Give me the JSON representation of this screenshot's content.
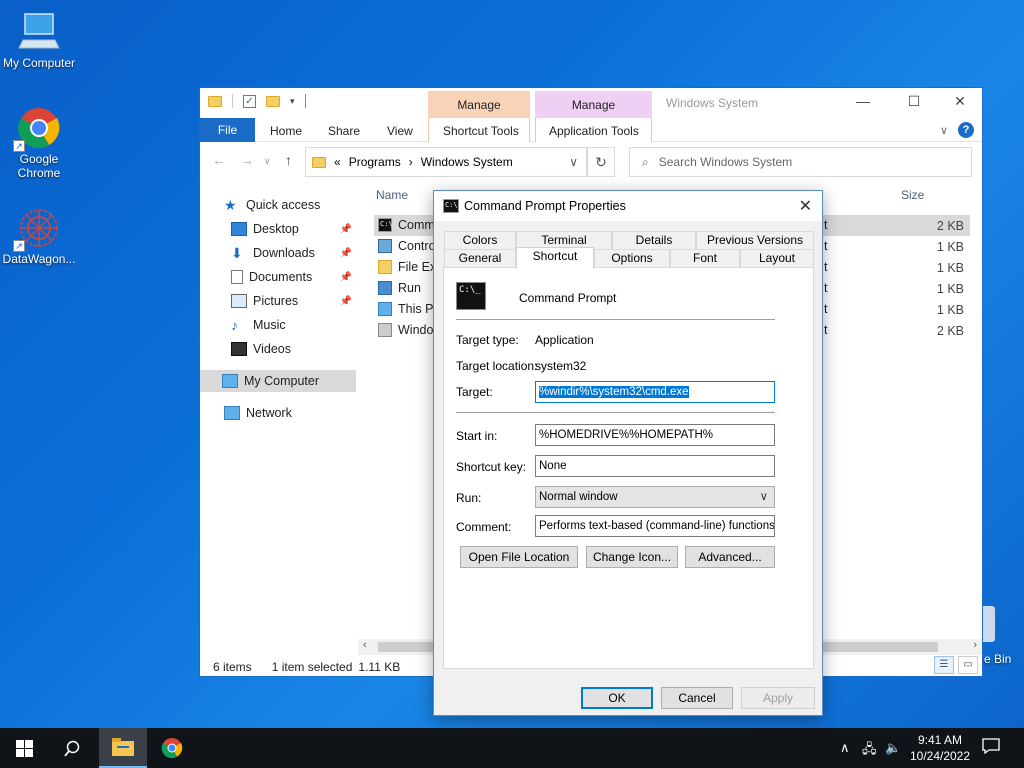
{
  "desktop": {
    "icons": [
      {
        "label": "My Computer"
      },
      {
        "label": "Google Chrome"
      },
      {
        "label": "DataWagon..."
      }
    ],
    "recycle_partial": "e Bin"
  },
  "explorer": {
    "title": "Windows System",
    "context_tabs": [
      {
        "header": "Manage",
        "tab": "Shortcut Tools",
        "color": "#f9d3b8"
      },
      {
        "header": "Manage",
        "tab": "Application Tools",
        "color": "#eed0f4"
      }
    ],
    "ribbon_tabs": [
      "File",
      "Home",
      "Share",
      "View"
    ],
    "address": {
      "chevron": "«",
      "parts": [
        "Programs",
        "Windows System"
      ]
    },
    "search_placeholder": "Search Windows System",
    "nav": [
      {
        "label": "Quick access"
      },
      {
        "label": "Desktop"
      },
      {
        "label": "Downloads"
      },
      {
        "label": "Documents"
      },
      {
        "label": "Pictures"
      },
      {
        "label": "Music"
      },
      {
        "label": "Videos"
      },
      {
        "label": "My Computer"
      },
      {
        "label": "Network"
      }
    ],
    "columns": {
      "name": "Name",
      "size": "Size"
    },
    "files": [
      {
        "name": "Comm",
        "size": "2 KB",
        "suffix": "t"
      },
      {
        "name": "Contro",
        "size": "1 KB",
        "suffix": "t"
      },
      {
        "name": "File Exp",
        "size": "1 KB",
        "suffix": "t"
      },
      {
        "name": "Run",
        "size": "1 KB",
        "suffix": "t"
      },
      {
        "name": "This PC",
        "size": "1 KB",
        "suffix": "t"
      },
      {
        "name": "Windov",
        "size": "2 KB",
        "suffix": "t"
      }
    ],
    "status": {
      "items": "6 items",
      "selected": "1 item selected",
      "size": "1.11 KB"
    }
  },
  "dialog": {
    "title": "Command Prompt Properties",
    "tabs_row1": [
      "Colors",
      "Terminal",
      "Details",
      "Previous Versions"
    ],
    "tabs_row2": [
      "General",
      "Shortcut",
      "Options",
      "Font",
      "Layout"
    ],
    "active_tab": "Shortcut",
    "app_name": "Command Prompt",
    "target_type_label": "Target type:",
    "target_type": "Application",
    "target_location_label": "Target location:",
    "target_location": "system32",
    "target_label": "Target:",
    "target": "%windir%\\system32\\cmd.exe",
    "start_in_label": "Start in:",
    "start_in": "%HOMEDRIVE%%HOMEPATH%",
    "shortcut_key_label": "Shortcut key:",
    "shortcut_key": "None",
    "run_label": "Run:",
    "run": "Normal window",
    "comment_label": "Comment:",
    "comment": "Performs text-based (command-line) functions.",
    "buttons": {
      "open_location": "Open File Location",
      "change_icon": "Change Icon...",
      "advanced": "Advanced...",
      "ok": "OK",
      "cancel": "Cancel",
      "apply": "Apply"
    }
  },
  "taskbar": {
    "time": "9:41 AM",
    "date": "10/24/2022"
  }
}
